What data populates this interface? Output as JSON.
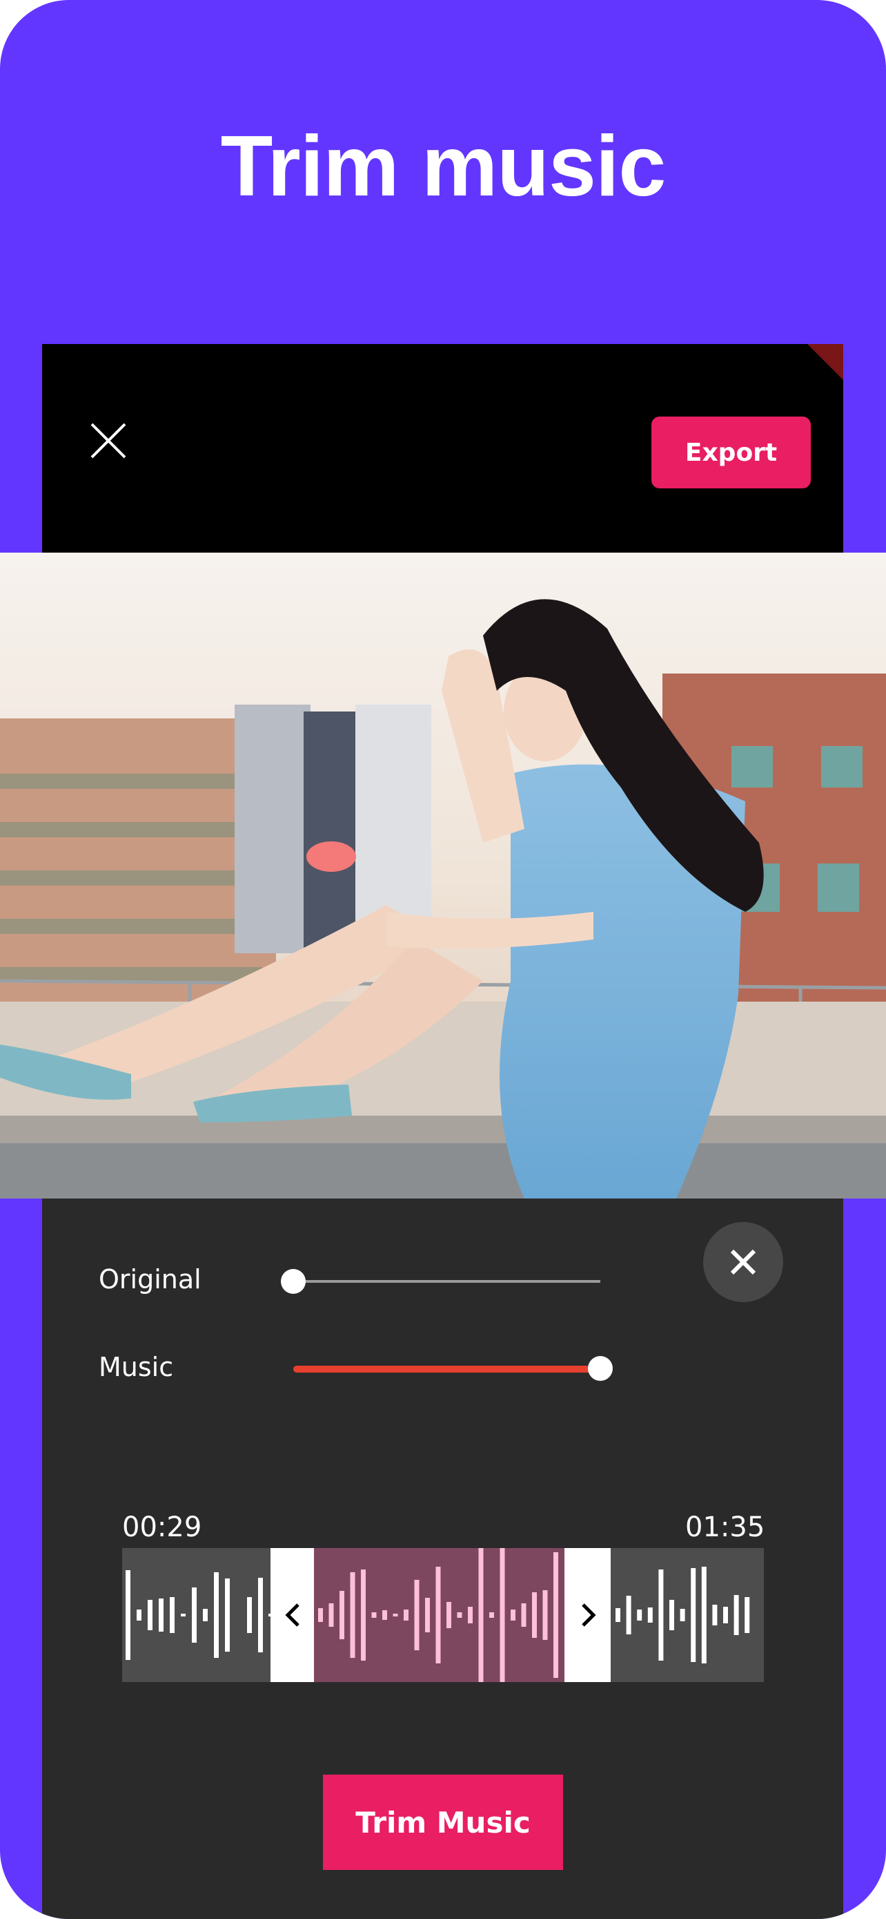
{
  "page": {
    "title": "Trim music",
    "background_color": "#6236FF",
    "accent_color": "#E91E63"
  },
  "editor_header": {
    "close_icon": "close-icon",
    "export_label": "Export"
  },
  "preview": {
    "description": "Photo of a woman in a light blue denim dress sitting on a rooftop ledge with blurred city buildings behind"
  },
  "volume": {
    "original": {
      "label": "Original",
      "level_fraction": 0.0
    },
    "music": {
      "label": "Music",
      "level_fraction": 1.0,
      "color": "#E8402F"
    },
    "close_icon": "close-icon"
  },
  "trimmer": {
    "start_time": "00:29",
    "end_time": "01:35",
    "left_handle_icon": "chevron-left-icon",
    "right_handle_icon": "chevron-right-icon",
    "selection_color": "#7E4760",
    "selected_wave_color": "#FFC0D9",
    "unselected_wave_color": "#FFFFFF"
  },
  "actions": {
    "trim_label": "Trim Music"
  }
}
